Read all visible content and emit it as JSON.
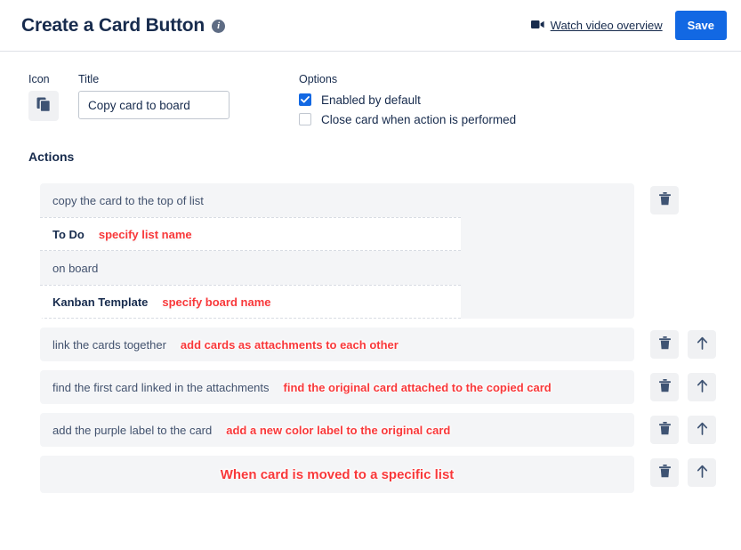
{
  "header": {
    "title": "Create a Card Button",
    "info_icon": "info-icon",
    "watch_video_label": "Watch video overview",
    "video_icon": "video-camera-icon",
    "save_label": "Save",
    "accent_color": "#1268e3"
  },
  "form": {
    "icon_label": "Icon",
    "icon_glyph": "copy-icon",
    "title_label": "Title",
    "title_value": "Copy card to board",
    "title_placeholder": "Copy card to board",
    "options_label": "Options",
    "options": [
      {
        "label": "Enabled by default",
        "checked": true
      },
      {
        "label": "Close card when action is performed",
        "checked": false
      }
    ]
  },
  "actions_section": {
    "heading": "Actions",
    "annotation_color": "#f8383a",
    "items": [
      {
        "lines": [
          {
            "kind": "text",
            "text": "copy the card to the top of list"
          },
          {
            "kind": "value",
            "text": "To Do",
            "annotation": "specify list name"
          },
          {
            "kind": "text",
            "text": "on board"
          },
          {
            "kind": "value",
            "text": "Kanban Template",
            "annotation": "specify board name"
          }
        ],
        "buttons": [
          {
            "name": "delete-action-button",
            "icon": "trash-icon"
          }
        ]
      },
      {
        "lines": [
          {
            "kind": "text",
            "text": "link the cards together",
            "annotation": "add cards as attachments to each other"
          }
        ],
        "buttons": [
          {
            "name": "delete-action-button",
            "icon": "trash-icon"
          },
          {
            "name": "move-action-up-button",
            "icon": "arrow-up-icon"
          }
        ]
      },
      {
        "lines": [
          {
            "kind": "text",
            "text": "find the first card linked in the attachments",
            "annotation": "find the  original card attached to the copied card"
          }
        ],
        "buttons": [
          {
            "name": "delete-action-button",
            "icon": "trash-icon"
          },
          {
            "name": "move-action-up-button",
            "icon": "arrow-up-icon"
          }
        ]
      },
      {
        "lines": [
          {
            "kind": "text",
            "text": "add the purple label to the card",
            "annotation": "add a new color label to the original card"
          }
        ],
        "buttons": [
          {
            "name": "delete-action-button",
            "icon": "trash-icon"
          },
          {
            "name": "move-action-up-button",
            "icon": "arrow-up-icon"
          }
        ]
      },
      {
        "lines": [
          {
            "kind": "centered-annotation",
            "text": "",
            "annotation": "When card is moved to a specific list"
          }
        ],
        "buttons": [
          {
            "name": "delete-action-button",
            "icon": "trash-icon"
          },
          {
            "name": "move-action-up-button",
            "icon": "arrow-up-icon"
          }
        ]
      }
    ]
  }
}
